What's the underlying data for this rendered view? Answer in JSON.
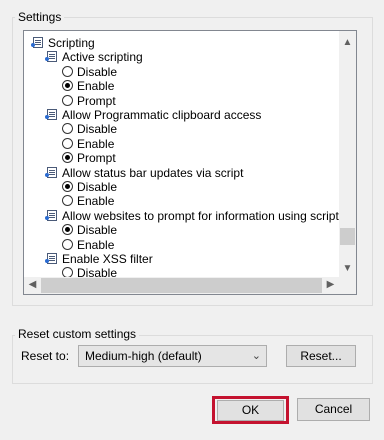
{
  "settings_group": {
    "title": "Settings",
    "items": [
      {
        "kind": "category",
        "label": "Scripting"
      },
      {
        "kind": "setting",
        "label": "Active scripting"
      },
      {
        "kind": "option",
        "label": "Disable",
        "checked": false
      },
      {
        "kind": "option",
        "label": "Enable",
        "checked": true
      },
      {
        "kind": "option",
        "label": "Prompt",
        "checked": false
      },
      {
        "kind": "setting",
        "label": "Allow Programmatic clipboard access"
      },
      {
        "kind": "option",
        "label": "Disable",
        "checked": false
      },
      {
        "kind": "option",
        "label": "Enable",
        "checked": false
      },
      {
        "kind": "option",
        "label": "Prompt",
        "checked": true
      },
      {
        "kind": "setting",
        "label": "Allow status bar updates via script"
      },
      {
        "kind": "option",
        "label": "Disable",
        "checked": true
      },
      {
        "kind": "option",
        "label": "Enable",
        "checked": false
      },
      {
        "kind": "setting",
        "label": "Allow websites to prompt for information using scripted wind"
      },
      {
        "kind": "option",
        "label": "Disable",
        "checked": true
      },
      {
        "kind": "option",
        "label": "Enable",
        "checked": false
      },
      {
        "kind": "setting",
        "label": "Enable XSS filter"
      },
      {
        "kind": "option",
        "label": "Disable",
        "checked": false
      }
    ]
  },
  "reset_group": {
    "title": "Reset custom settings",
    "reset_to_label": "Reset to:",
    "dropdown_value": "Medium-high (default)",
    "reset_button": "Reset..."
  },
  "footer": {
    "ok": "OK",
    "cancel": "Cancel"
  },
  "icons": {
    "scroll_up": "▲",
    "scroll_down": "▼",
    "scroll_left": "◀",
    "scroll_right": "▶",
    "dropdown": "⌄"
  }
}
